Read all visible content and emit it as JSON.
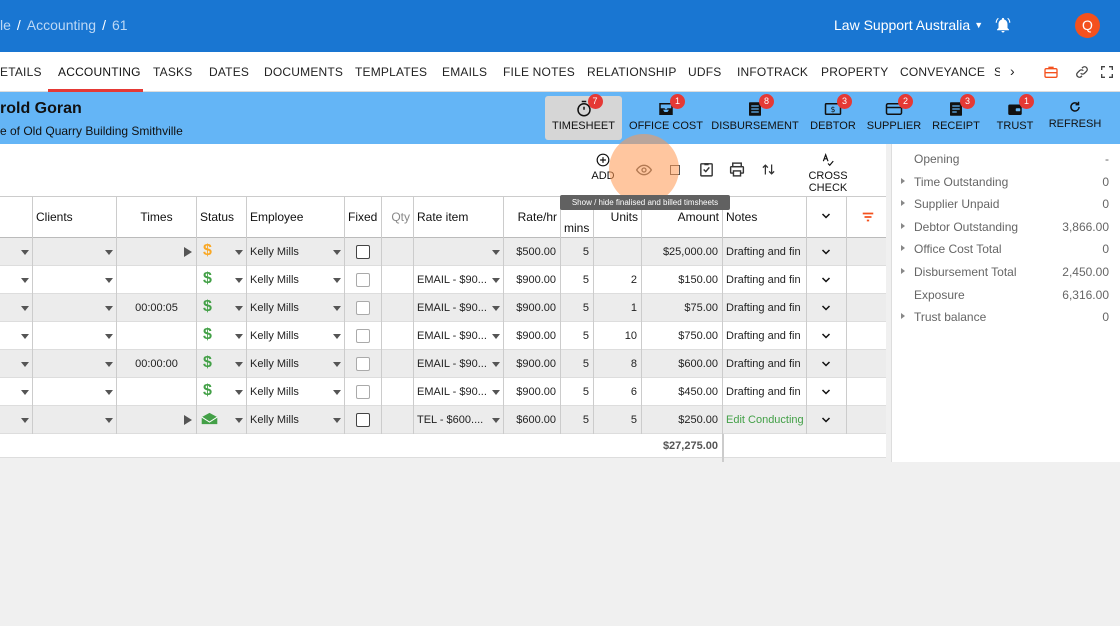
{
  "breadcrumb": {
    "part1": "le",
    "part2": "Accounting",
    "part3": "61"
  },
  "header": {
    "org": "Law Support Australia",
    "avatar_initial": "Q"
  },
  "tabs": [
    "ETAILS",
    "ACCOUNTING",
    "TASKS",
    "DATES",
    "DOCUMENTS",
    "TEMPLATES",
    "EMAILS",
    "FILE NOTES",
    "RELATIONSHIP",
    "UDFS",
    "INFOTRACK",
    "PROPERTY",
    "CONVEYANCE",
    "S"
  ],
  "matter": {
    "name": "rold Goran",
    "description": "e of Old Quarry Building Smithville"
  },
  "matter_buttons": [
    {
      "label": "TIMESHEET",
      "badge": "7"
    },
    {
      "label": "OFFICE COST",
      "badge": "1"
    },
    {
      "label": "DISBURSEMENT",
      "badge": "8"
    },
    {
      "label": "DEBTOR",
      "badge": "3"
    },
    {
      "label": "SUPPLIER",
      "badge": "2"
    },
    {
      "label": "RECEIPT",
      "badge": "3"
    },
    {
      "label": "TRUST",
      "badge": "1"
    },
    {
      "label": "REFRESH",
      "badge": ""
    }
  ],
  "toolbar": {
    "add": "ADD",
    "cross_check": "CROSS CHECK",
    "tooltip": "Show / hide finalised and billed timsheets"
  },
  "columns": {
    "clients": "Clients",
    "times": "Times",
    "status": "Status",
    "employee": "Employee",
    "fixed": "Fixed",
    "qty": "Qty",
    "rate_item": "Rate item",
    "rate": "Rate/hr",
    "mins": "mins",
    "units": "Units",
    "amount": "Amount",
    "notes": "Notes"
  },
  "rows": [
    {
      "times": "",
      "status": "dollar-orange",
      "employee": "Kelly Mills",
      "rate_item": "",
      "rate": "$500.00",
      "mins": "5",
      "units": "",
      "amount": "$25,000.00",
      "notes": "Drafting and fin",
      "play": true
    },
    {
      "times": "",
      "status": "dollar",
      "employee": "Kelly Mills",
      "rate_item": "EMAIL - $90...",
      "rate": "$900.00",
      "mins": "5",
      "units": "2",
      "amount": "$150.00",
      "notes": "Drafting and fin",
      "play": false
    },
    {
      "times": "00:00:05",
      "status": "dollar",
      "employee": "Kelly Mills",
      "rate_item": "EMAIL - $90...",
      "rate": "$900.00",
      "mins": "5",
      "units": "1",
      "amount": "$75.00",
      "notes": "Drafting and fin",
      "play": false
    },
    {
      "times": "",
      "status": "dollar",
      "employee": "Kelly Mills",
      "rate_item": "EMAIL - $90...",
      "rate": "$900.00",
      "mins": "5",
      "units": "10",
      "amount": "$750.00",
      "notes": "Drafting and fin",
      "play": false
    },
    {
      "times": "00:00:00",
      "status": "dollar",
      "employee": "Kelly Mills",
      "rate_item": "EMAIL - $90...",
      "rate": "$900.00",
      "mins": "5",
      "units": "8",
      "amount": "$600.00",
      "notes": "Drafting and fin",
      "play": false
    },
    {
      "times": "",
      "status": "dollar",
      "employee": "Kelly Mills",
      "rate_item": "EMAIL - $90...",
      "rate": "$900.00",
      "mins": "5",
      "units": "6",
      "amount": "$450.00",
      "notes": "Drafting and fin",
      "play": false
    },
    {
      "times": "",
      "status": "envelope",
      "employee": "Kelly Mills",
      "rate_item": "TEL - $600....",
      "rate": "$600.00",
      "mins": "5",
      "units": "5",
      "amount": "$250.00",
      "notes": "Edit Conducting",
      "play": true
    }
  ],
  "total": "$27,275.00",
  "summary": [
    {
      "label": "Opening",
      "value": "-",
      "arrow": false
    },
    {
      "label": "Time Outstanding",
      "value": "0",
      "arrow": true
    },
    {
      "label": "Supplier Unpaid",
      "value": "0",
      "arrow": true
    },
    {
      "label": "Debtor Outstanding",
      "value": "3,866.00",
      "arrow": true
    },
    {
      "label": "Office Cost Total",
      "value": "0",
      "arrow": true
    },
    {
      "label": "Disbursement Total",
      "value": "2,450.00",
      "arrow": true
    },
    {
      "label": "Exposure",
      "value": "6,316.00",
      "arrow": false
    },
    {
      "label": "Trust balance",
      "value": "0",
      "arrow": true
    }
  ]
}
